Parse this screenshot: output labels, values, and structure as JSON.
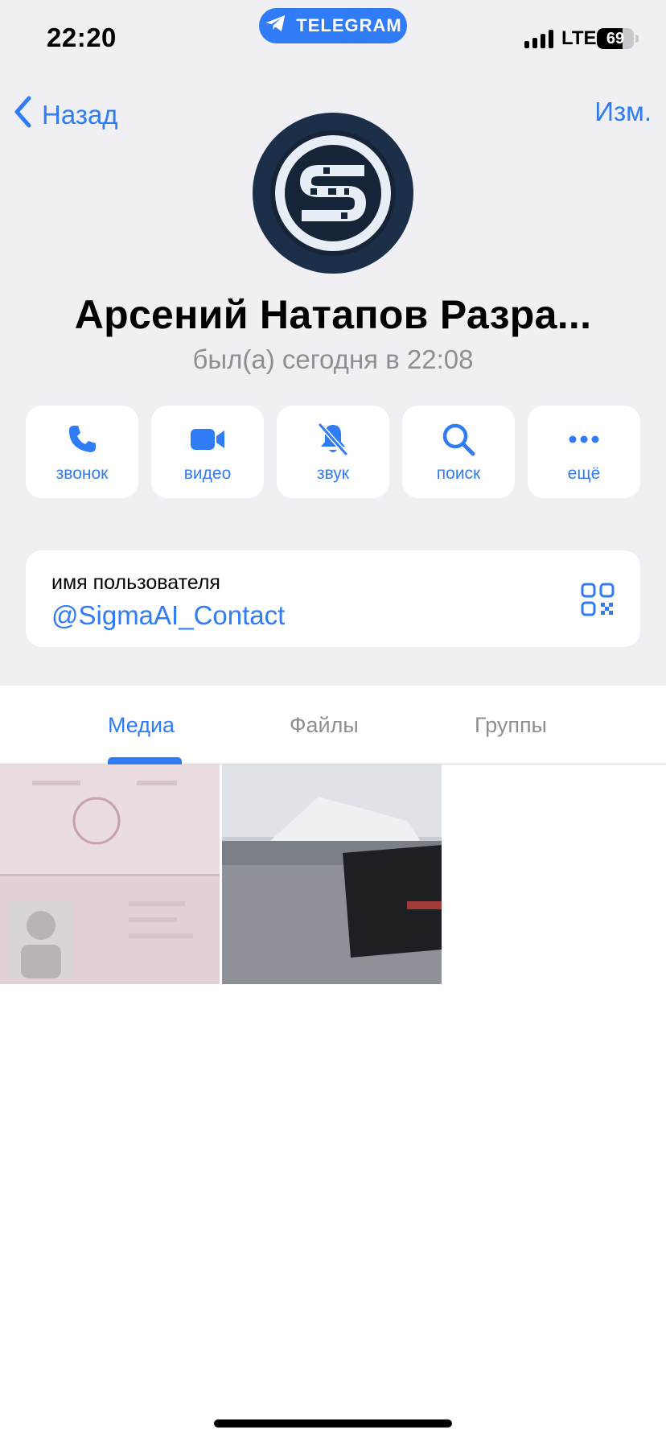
{
  "status_bar": {
    "time": "22:20",
    "app_pill": "TELEGRAM",
    "network": "LTE",
    "battery_level": "69",
    "battery_fraction": 0.69
  },
  "nav": {
    "back_label": "Назад",
    "edit_label": "Изм."
  },
  "profile": {
    "name": "Арсений Натапов Разра...",
    "last_seen": "был(а) сегодня в 22:08"
  },
  "actions": [
    {
      "label": "звонок",
      "icon": "phone-icon"
    },
    {
      "label": "видео",
      "icon": "video-icon"
    },
    {
      "label": "звук",
      "icon": "bell-slash-icon"
    },
    {
      "label": "поиск",
      "icon": "search-icon"
    },
    {
      "label": "ещё",
      "icon": "more-icon"
    }
  ],
  "username_card": {
    "label": "имя пользователя",
    "value": "@SigmaAI_Contact",
    "icon": "qr-code-icon"
  },
  "tabs": [
    {
      "label": "Медиа",
      "active": true
    },
    {
      "label": "Файлы",
      "active": false
    },
    {
      "label": "Группы",
      "active": false
    }
  ],
  "media": [
    {
      "kind": "image-thumbnail"
    },
    {
      "kind": "image-thumbnail"
    }
  ],
  "colors": {
    "accent": "#2f7cf6",
    "secondary_text": "#8e8e93",
    "grouped_background": "#efeff4",
    "avatar_background": "#1c2f48"
  }
}
